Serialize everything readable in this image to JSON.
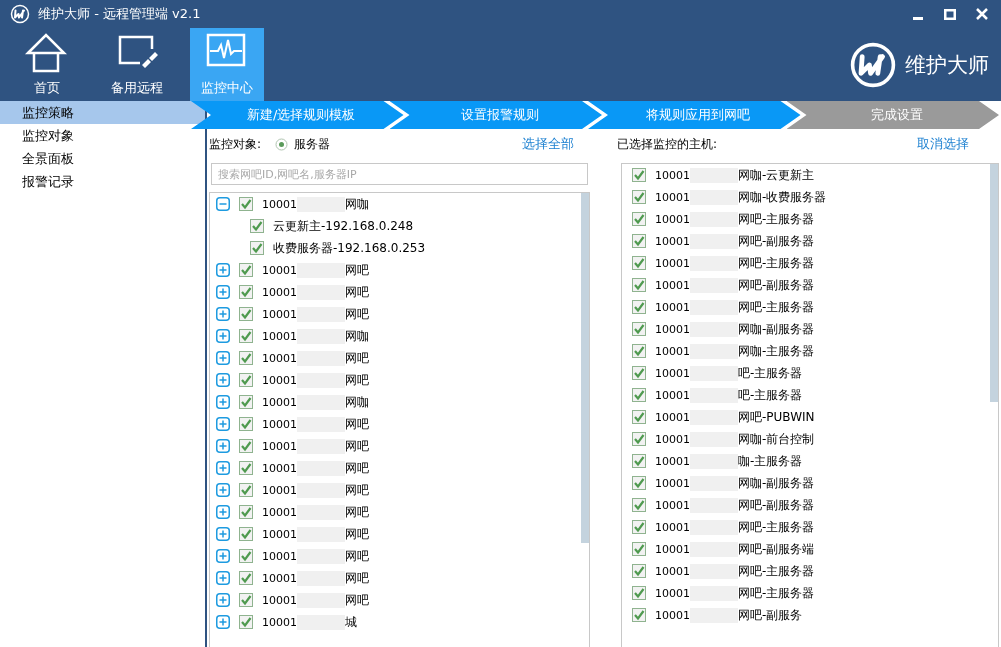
{
  "window": {
    "title": "维护大师 - 远程管理端 v2.1"
  },
  "toolbar": {
    "tabs": [
      {
        "label": "首页",
        "selected": false
      },
      {
        "label": "备用远程",
        "selected": false
      },
      {
        "label": "监控中心",
        "selected": true
      }
    ],
    "brand": "维护大师"
  },
  "sidebar": {
    "items": [
      {
        "label": "监控策略",
        "selected": true
      },
      {
        "label": "监控对象",
        "selected": false
      },
      {
        "label": "全景面板",
        "selected": false
      },
      {
        "label": "报警记录",
        "selected": false
      }
    ]
  },
  "steps": [
    {
      "label": "新建/选择规则模板",
      "done": true
    },
    {
      "label": "设置报警规则",
      "done": true
    },
    {
      "label": "将规则应用到网吧",
      "done": true
    },
    {
      "label": "完成设置",
      "done": false
    }
  ],
  "left_panel": {
    "target_label": "监控对象:",
    "target_option": {
      "label": "服务器",
      "selected": true
    },
    "select_all": "选择全部",
    "search": {
      "placeholder": "搜索网吧ID,网吧名,服务器IP"
    },
    "tree": [
      {
        "id": "10001",
        "name": "网咖",
        "checked": true,
        "expanded": true,
        "children": [
          {
            "name": "云更新主-192.168.0.248",
            "checked": true
          },
          {
            "name": "收费服务器-192.168.0.253",
            "checked": true
          }
        ]
      },
      {
        "id": "10001",
        "name": "网吧",
        "checked": true,
        "expanded": false
      },
      {
        "id": "10001",
        "name": "网吧",
        "checked": true,
        "expanded": false
      },
      {
        "id": "10001",
        "name": "网吧",
        "checked": true,
        "expanded": false
      },
      {
        "id": "10001",
        "name": "网咖",
        "checked": true,
        "expanded": false
      },
      {
        "id": "10001",
        "name": "网吧",
        "checked": true,
        "expanded": false
      },
      {
        "id": "10001",
        "name": "网吧",
        "checked": true,
        "expanded": false
      },
      {
        "id": "10001",
        "name": "网咖",
        "checked": true,
        "expanded": false
      },
      {
        "id": "10001",
        "name": "网吧",
        "checked": true,
        "expanded": false
      },
      {
        "id": "10001",
        "name": "网吧",
        "checked": true,
        "expanded": false
      },
      {
        "id": "10001",
        "name": "网吧",
        "checked": true,
        "expanded": false
      },
      {
        "id": "10001",
        "name": "网吧",
        "checked": true,
        "expanded": false
      },
      {
        "id": "10001",
        "name": "网吧",
        "checked": true,
        "expanded": false
      },
      {
        "id": "10001",
        "name": "网吧",
        "checked": true,
        "expanded": false
      },
      {
        "id": "10001",
        "name": "网吧",
        "checked": true,
        "expanded": false
      },
      {
        "id": "10001",
        "name": "网吧",
        "checked": true,
        "expanded": false
      },
      {
        "id": "10001",
        "name": "网吧",
        "checked": true,
        "expanded": false
      },
      {
        "id": "10001",
        "name": "城",
        "checked": true,
        "expanded": false
      }
    ]
  },
  "right_panel": {
    "label": "已选择监控的主机:",
    "clear": "取消选择",
    "hosts": [
      {
        "id": "10001",
        "name": "网咖-云更新主",
        "checked": true
      },
      {
        "id": "10001",
        "name": "网咖-收费服务器",
        "checked": true
      },
      {
        "id": "10001",
        "name": "网吧-主服务器",
        "checked": true
      },
      {
        "id": "10001",
        "name": "网吧-副服务器",
        "checked": true
      },
      {
        "id": "10001",
        "name": "网吧-主服务器",
        "checked": true
      },
      {
        "id": "10001",
        "name": "网吧-副服务器",
        "checked": true
      },
      {
        "id": "10001",
        "name": "网吧-主服务器",
        "checked": true
      },
      {
        "id": "10001",
        "name": "网咖-副服务器",
        "checked": true
      },
      {
        "id": "10001",
        "name": "网咖-主服务器",
        "checked": true
      },
      {
        "id": "10001",
        "name": "吧-主服务器",
        "checked": true
      },
      {
        "id": "10001",
        "name": "吧-主服务器",
        "checked": true
      },
      {
        "id": "10001",
        "name": "网吧-PUBWIN",
        "checked": true
      },
      {
        "id": "10001",
        "name": "网咖-前台控制",
        "checked": true
      },
      {
        "id": "10001",
        "name": "咖-主服务器",
        "checked": true
      },
      {
        "id": "10001",
        "name": "网咖-副服务器",
        "checked": true
      },
      {
        "id": "10001",
        "name": "网吧-副服务器",
        "checked": true
      },
      {
        "id": "10001",
        "name": "网吧-主服务器",
        "checked": true
      },
      {
        "id": "10001",
        "name": "网吧-副服务端",
        "checked": true
      },
      {
        "id": "10001",
        "name": "网吧-主服务器",
        "checked": true
      },
      {
        "id": "10001",
        "name": "网吧-主服务器",
        "checked": true
      },
      {
        "id": "10001",
        "name": "网吧-副服务",
        "checked": true
      }
    ]
  }
}
